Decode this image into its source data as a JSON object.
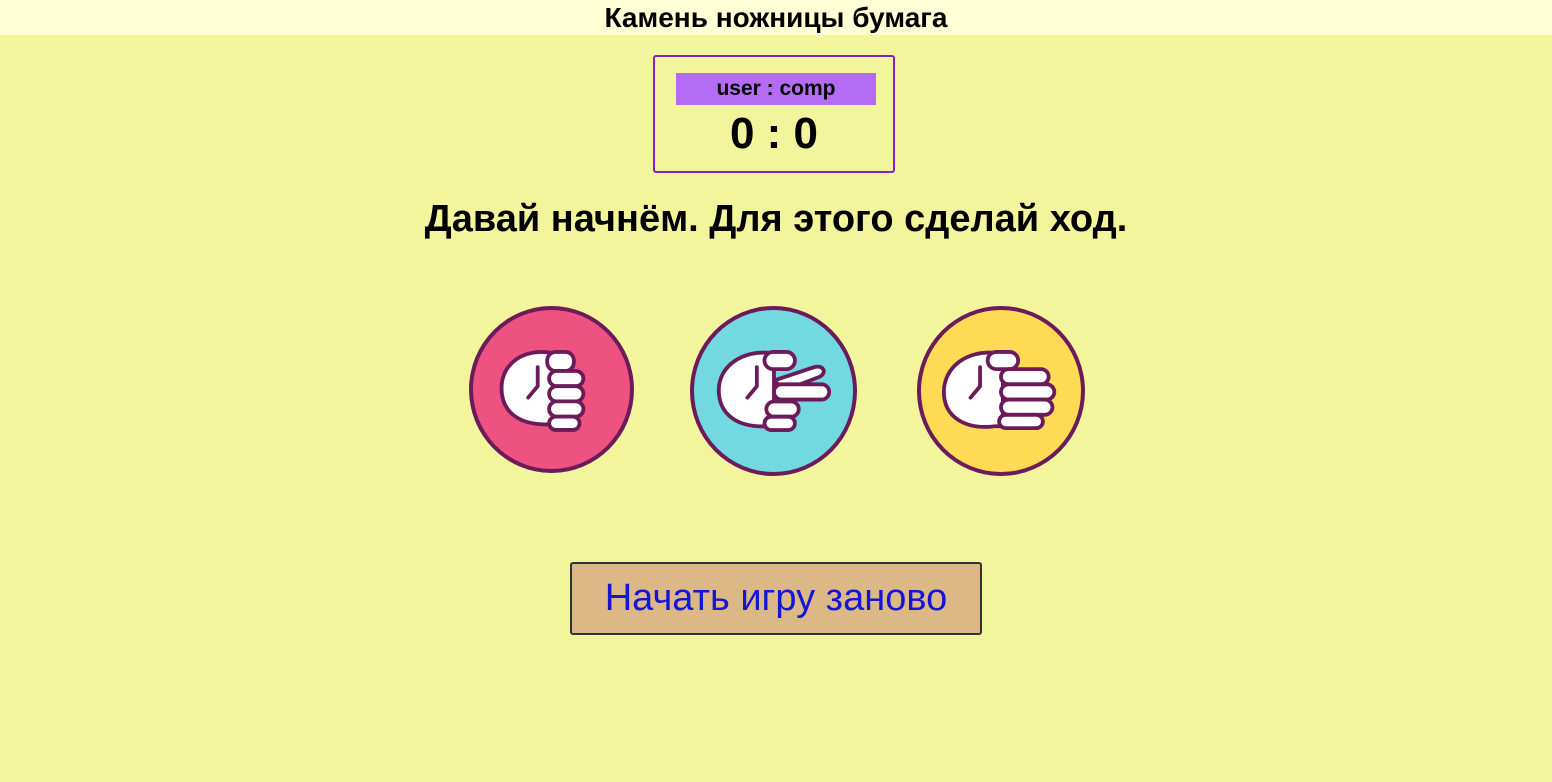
{
  "header": {
    "title": "Камень ножницы бумага"
  },
  "scoreboard": {
    "label": "user : comp",
    "score": "0 : 0",
    "user_score": 0,
    "comp_score": 0
  },
  "message": "Давай начнём. Для этого сделай ход.",
  "choices": [
    {
      "name": "rock",
      "icon": "rock-hand-icon",
      "color": "#ee5280"
    },
    {
      "name": "scissors",
      "icon": "scissors-hand-icon",
      "color": "#73d9e1"
    },
    {
      "name": "paper",
      "icon": "paper-hand-icon",
      "color": "#ffdb55"
    }
  ],
  "restart_button": {
    "label": "Начать игру заново"
  },
  "colors": {
    "background": "#f3f59d",
    "title_bar": "#ffffd5",
    "score_border": "#7e22ce",
    "score_label_bg": "#b56cf5",
    "icon_outline": "#6b1a5a",
    "button_bg": "#dcb887",
    "button_text": "#1515d6"
  }
}
